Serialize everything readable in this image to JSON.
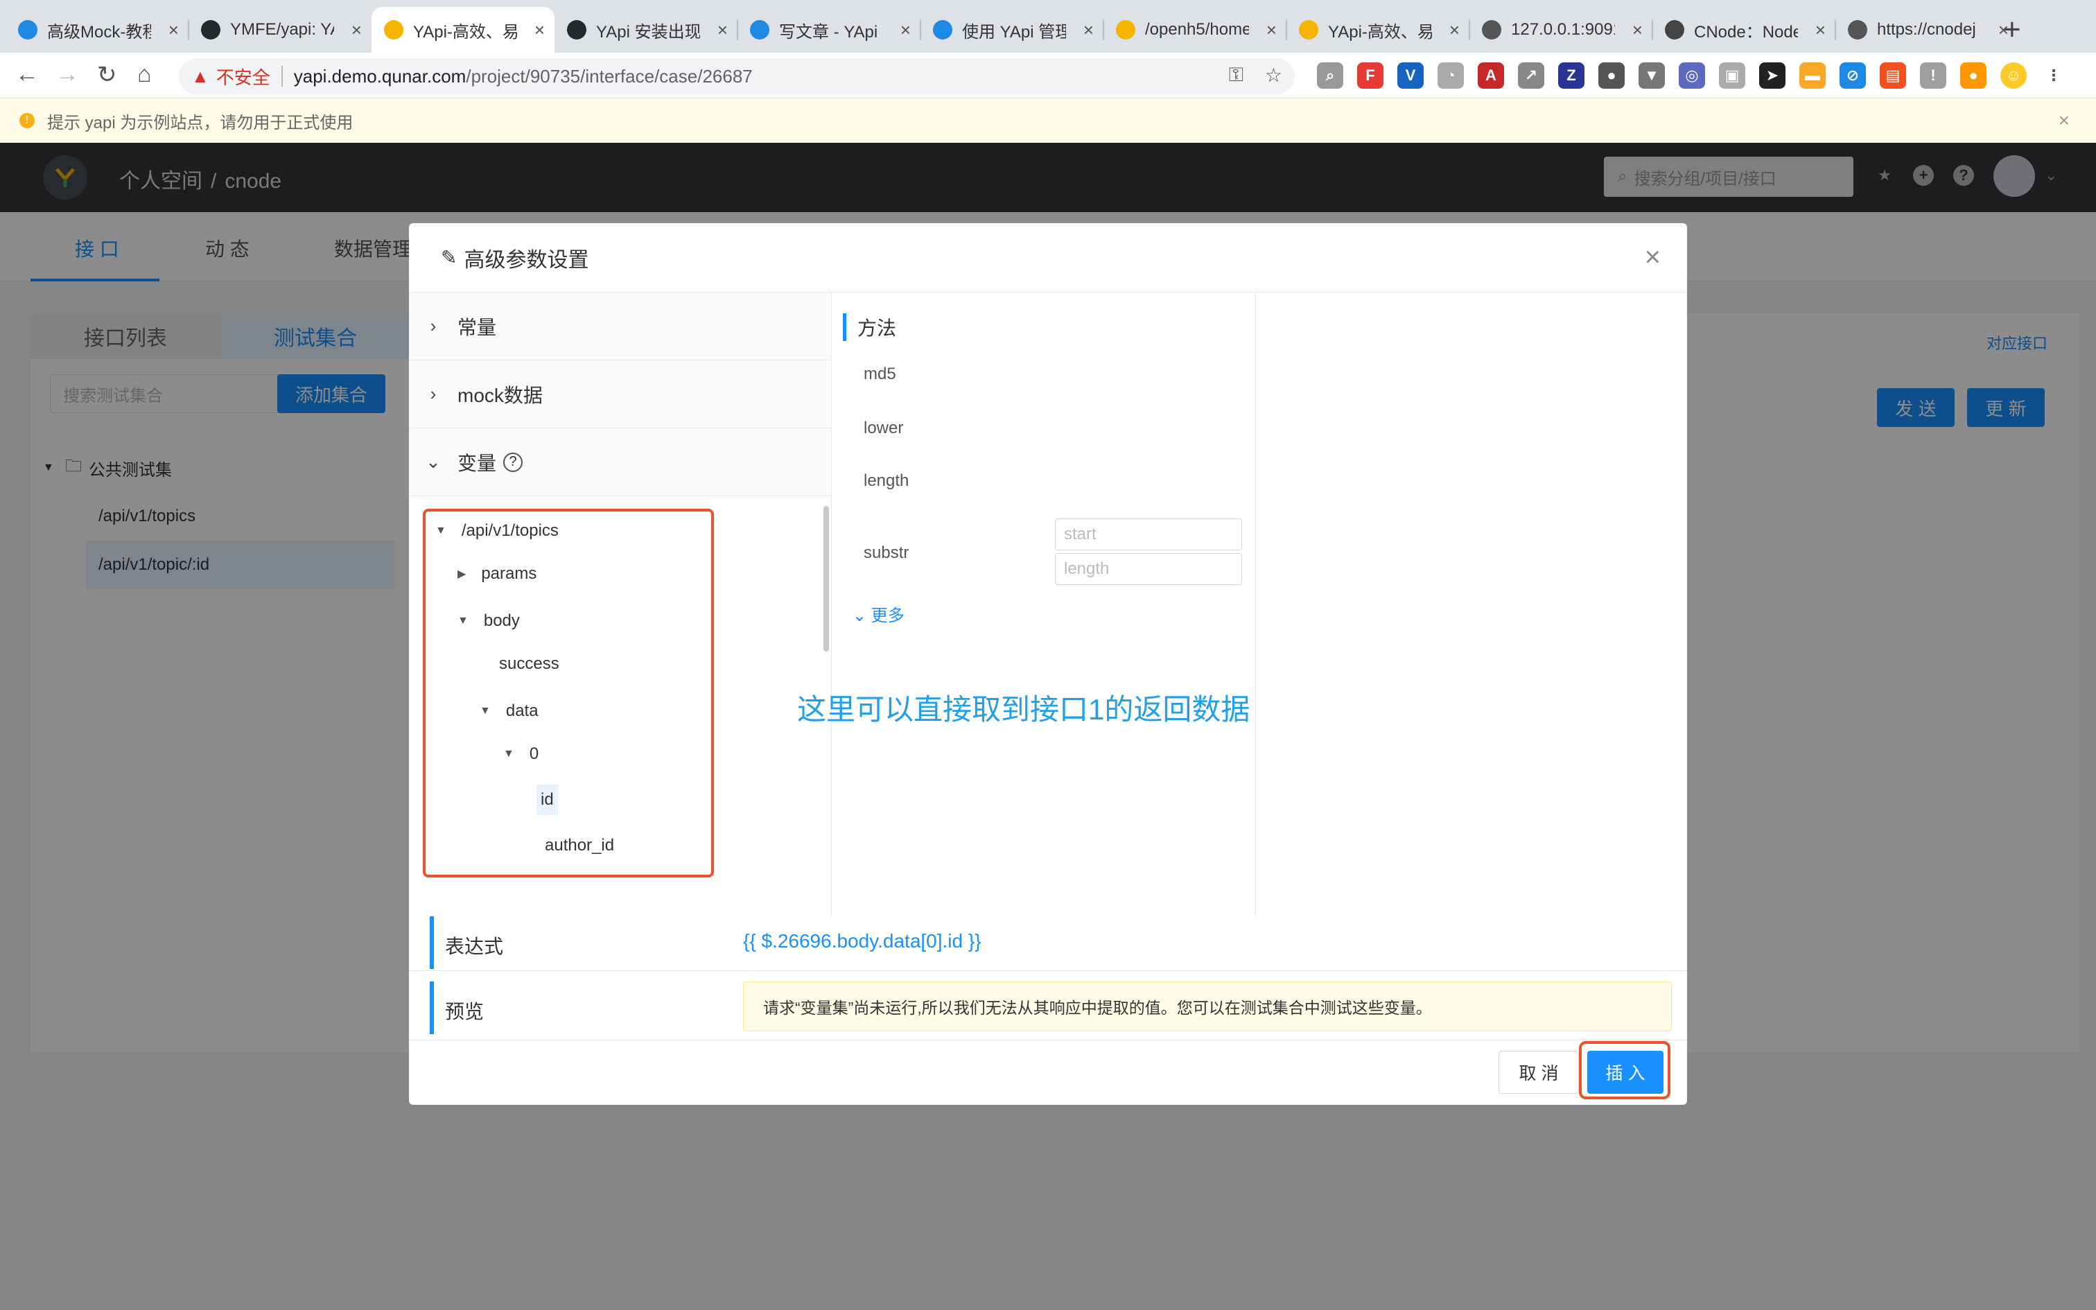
{
  "browser": {
    "tabs": [
      {
        "title": "高级Mock-教程",
        "color": "#1e88e5"
      },
      {
        "title": "YMFE/yapi: YA",
        "color": "#24292e"
      },
      {
        "title": "YApi-高效、易",
        "color": "#f5b400"
      },
      {
        "title": "YApi 安装出现",
        "color": "#24292e"
      },
      {
        "title": "写文章 - YApi",
        "color": "#1e88e5"
      },
      {
        "title": "使用 YApi 管理",
        "color": "#1e88e5"
      },
      {
        "title": "/openh5/home",
        "color": "#f5b400"
      },
      {
        "title": "YApi-高效、易",
        "color": "#f5b400"
      },
      {
        "title": "127.0.0.1:9091",
        "color": "#555555"
      },
      {
        "title": "CNode：Node",
        "color": "#444444"
      },
      {
        "title": "https://cnodej",
        "color": "#555555"
      }
    ],
    "active_tab": 2,
    "new_tab": "+",
    "insecure_label": "不安全",
    "url_host": "yapi.demo.qunar.com",
    "url_path": "/project/90735/interface/case/26687"
  },
  "notice": {
    "text": "提示 yapi 为示例站点，请勿用于正式使用",
    "close": "×"
  },
  "header": {
    "space": "个人空间",
    "project": "cnode",
    "search_placeholder": "搜索分组/项目/接口"
  },
  "subnav": {
    "items": [
      "接 口",
      "动 态",
      "数据管理"
    ]
  },
  "left": {
    "tabs": [
      "接口列表",
      "测试集合"
    ],
    "search_placeholder": "搜索测试集合",
    "add_button": "添加集合",
    "folder": "公共测试集",
    "cases": [
      "/api/v1/topics",
      "/api/v1/topic/:id"
    ]
  },
  "right": {
    "link": "对应接口",
    "send": "发 送",
    "update": "更 新"
  },
  "modal": {
    "title": "高级参数设置",
    "sections": [
      "常量",
      "mock数据",
      "变量"
    ],
    "tree": {
      "root": "/api/v1/topics",
      "params": "params",
      "body": "body",
      "success": "success",
      "data": "data",
      "zero": "0",
      "id": "id",
      "author_id": "author_id"
    },
    "methods_title": "方法",
    "methods": [
      "md5",
      "lower",
      "length",
      "substr"
    ],
    "substr_placeholders": [
      "start",
      "length"
    ],
    "more": "更多",
    "expr_label": "表达式",
    "expr_value": "{{ $.26696.body.data[0].id }}",
    "preview_label": "预览",
    "preview_text": "请求“变量集”尚未运行,所以我们无法从其响应中提取的值。您可以在测试集合中测试这些变量。",
    "cancel": "取 消",
    "insert": "插 入"
  },
  "annotation": "这里可以直接取到接口1的返回数据"
}
